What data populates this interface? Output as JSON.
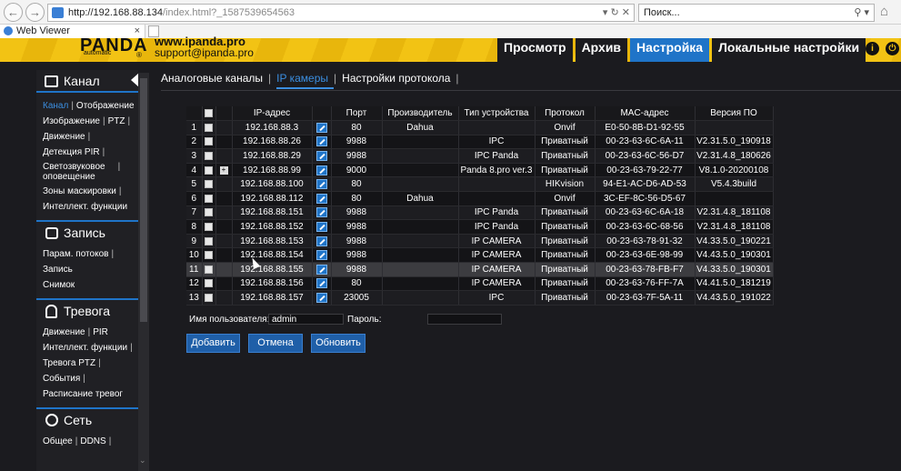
{
  "browser": {
    "url_main": "http://192.168.88.134",
    "url_rest": "/index.html?_1587539654563",
    "search_placeholder": "Поиск...",
    "tab_title": "Web Viewer"
  },
  "header": {
    "logo": "PANDA",
    "logo_sub": "automatic",
    "logo_reg": "®",
    "site": "www.ipanda.pro",
    "support": "support@ipanda.pro",
    "nav": [
      "Просмотр",
      "Архив",
      "Настройка",
      "Локальные настройки"
    ],
    "active_nav": "Настройка"
  },
  "sidebar": {
    "channel": {
      "title": "Канал",
      "items": {
        "kanal": "Канал",
        "display": "Отображение",
        "image": "Изображение",
        "ptz": "PTZ",
        "motion": "Движение",
        "pir": "Детекция PIR",
        "sound_light_1": "Светозвуковое",
        "sound_light_2": "оповещение",
        "mask": "Зоны маскировки",
        "intel": "Интеллект. функции"
      }
    },
    "record": {
      "title": "Запись",
      "items": {
        "streams": "Парам. потоков",
        "rec": "Запись",
        "snapshot": "Снимок"
      }
    },
    "alarm": {
      "title": "Тревога",
      "items": {
        "motion": "Движение",
        "pir": "PIR",
        "intel": "Интеллект. функции",
        "ptz": "Тревога PTZ",
        "events": "События",
        "schedule": "Расписание тревог"
      }
    },
    "network": {
      "title": "Сеть",
      "items": {
        "general": "Общее",
        "ddns": "DDNS"
      }
    }
  },
  "subtabs": [
    "Аналоговые каналы",
    "IP камеры",
    "Настройки протокола"
  ],
  "table": {
    "headers": [
      "IP-адрес",
      "Порт",
      "Производитель",
      "Тип устройства",
      "Протокол",
      "MAC-адрес",
      "Версия ПО"
    ],
    "rows": [
      [
        "1",
        "192.168.88.3",
        "80",
        "Dahua",
        "",
        "Onvif",
        "E0-50-8B-D1-92-55",
        ""
      ],
      [
        "2",
        "192.168.88.26",
        "9988",
        "",
        "IPC",
        "Приватный",
        "00-23-63-6C-6A-11",
        "V2.31.5.0_190918"
      ],
      [
        "3",
        "192.168.88.29",
        "9988",
        "",
        "IPC Panda",
        "Приватный",
        "00-23-63-6C-56-D7",
        "V2.31.4.8_180626"
      ],
      [
        "4",
        "192.168.88.99",
        "9000",
        "",
        "Panda 8.pro ver.3",
        "Приватный",
        "00-23-63-79-22-77",
        "V8.1.0-20200108"
      ],
      [
        "5",
        "192.168.88.100",
        "80",
        "",
        "",
        "HIKvision",
        "94-E1-AC-D6-AD-53",
        "V5.4.3build"
      ],
      [
        "6",
        "192.168.88.112",
        "80",
        "Dahua",
        "",
        "Onvif",
        "3C-EF-8C-56-D5-67",
        ""
      ],
      [
        "7",
        "192.168.88.151",
        "9988",
        "",
        "IPC Panda",
        "Приватный",
        "00-23-63-6C-6A-18",
        "V2.31.4.8_181108"
      ],
      [
        "8",
        "192.168.88.152",
        "9988",
        "",
        "IPC Panda",
        "Приватный",
        "00-23-63-6C-68-56",
        "V2.31.4.8_181108"
      ],
      [
        "9",
        "192.168.88.153",
        "9988",
        "",
        "IP CAMERA",
        "Приватный",
        "00-23-63-78-91-32",
        "V4.33.5.0_190221"
      ],
      [
        "10",
        "192.168.88.154",
        "9988",
        "",
        "IP CAMERA",
        "Приватный",
        "00-23-63-6E-98-99",
        "V4.43.5.0_190301"
      ],
      [
        "11",
        "192.168.88.155",
        "9988",
        "",
        "IP CAMERA",
        "Приватный",
        "00-23-63-78-FB-F7",
        "V4.33.5.0_190301"
      ],
      [
        "12",
        "192.168.88.156",
        "80",
        "",
        "IP CAMERA",
        "Приватный",
        "00-23-63-76-FF-7A",
        "V4.41.5.0_181219"
      ],
      [
        "13",
        "192.168.88.157",
        "23005",
        "",
        "IPC",
        "Приватный",
        "00-23-63-7F-5A-11",
        "V4.43.5.0_191022"
      ]
    ]
  },
  "credentials": {
    "user_label": "Имя пользователя:",
    "user_value": "admin",
    "pass_label": "Пароль:"
  },
  "buttons": {
    "add": "Добавить",
    "cancel": "Отмена",
    "refresh": "Обновить"
  }
}
